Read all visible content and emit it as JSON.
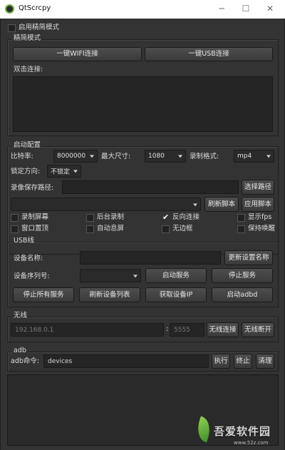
{
  "window": {
    "title": "QtScrcpy",
    "minimize": "─",
    "maximize": "☐",
    "close": "✕"
  },
  "simple_mode": {
    "checkbox_label": "启用精简模式",
    "checked": false
  },
  "simple_group": {
    "title": "精简模式",
    "wifi_button": "一键WIFI连接",
    "usb_button": "一键USB连接",
    "double_click_label": "双击连接:"
  },
  "config": {
    "title": "启动配置",
    "bitrate_label": "比特率:",
    "bitrate_value": "8000000",
    "max_size_label": "最大尺寸:",
    "max_size_value": "1080",
    "record_format_label": "录制格式:",
    "record_format_value": "mp4",
    "lock_orientation_label": "锁定方向:",
    "lock_orientation_value": "不锁定",
    "record_path_label": "录像保存路径:",
    "record_path_value": "",
    "select_path_button": "选择路径",
    "script_value": "",
    "refresh_script_button": "刷新脚本",
    "apply_script_button": "应用脚本",
    "options": [
      {
        "label": "录制屏幕",
        "checked": false
      },
      {
        "label": "后台录制",
        "checked": false
      },
      {
        "label": "反向连接",
        "checked": true
      },
      {
        "label": "显示fps",
        "checked": false
      },
      {
        "label": "窗口置顶",
        "checked": false
      },
      {
        "label": "自动息屏",
        "checked": false
      },
      {
        "label": "无边框",
        "checked": false
      },
      {
        "label": "保持唤醒",
        "checked": false
      }
    ]
  },
  "usb": {
    "title": "USB线",
    "device_name_label": "设备名称:",
    "device_name_value": "",
    "update_name_button": "更新设置名称",
    "serial_label": "设备序列号:",
    "serial_value": "",
    "start_service_button": "启动服务",
    "stop_service_button": "停止服务",
    "stop_all_button": "停止所有服务",
    "refresh_devices_button": "刷新设备列表",
    "get_ip_button": "获取设备IP",
    "start_adbd_button": "启动adbd"
  },
  "wireless": {
    "title": "无线",
    "ip_placeholder": "192.168.0.1",
    "separator": ":",
    "port_placeholder": "5555",
    "connect_button": "无线连接",
    "disconnect_button": "无线断开"
  },
  "adb": {
    "title": "adb",
    "command_label": "adb命令:",
    "command_value": "devices",
    "execute_button": "执行",
    "terminate_button": "终止",
    "clear_button": "清理"
  },
  "watermark": {
    "brand": "吾爱软件园",
    "url": "www.52z.com"
  },
  "colors": {
    "window_bg": "#333333",
    "titlebar_bg": "#ffffff",
    "field_bg": "#252525",
    "accent_green": "#6cb33f"
  }
}
